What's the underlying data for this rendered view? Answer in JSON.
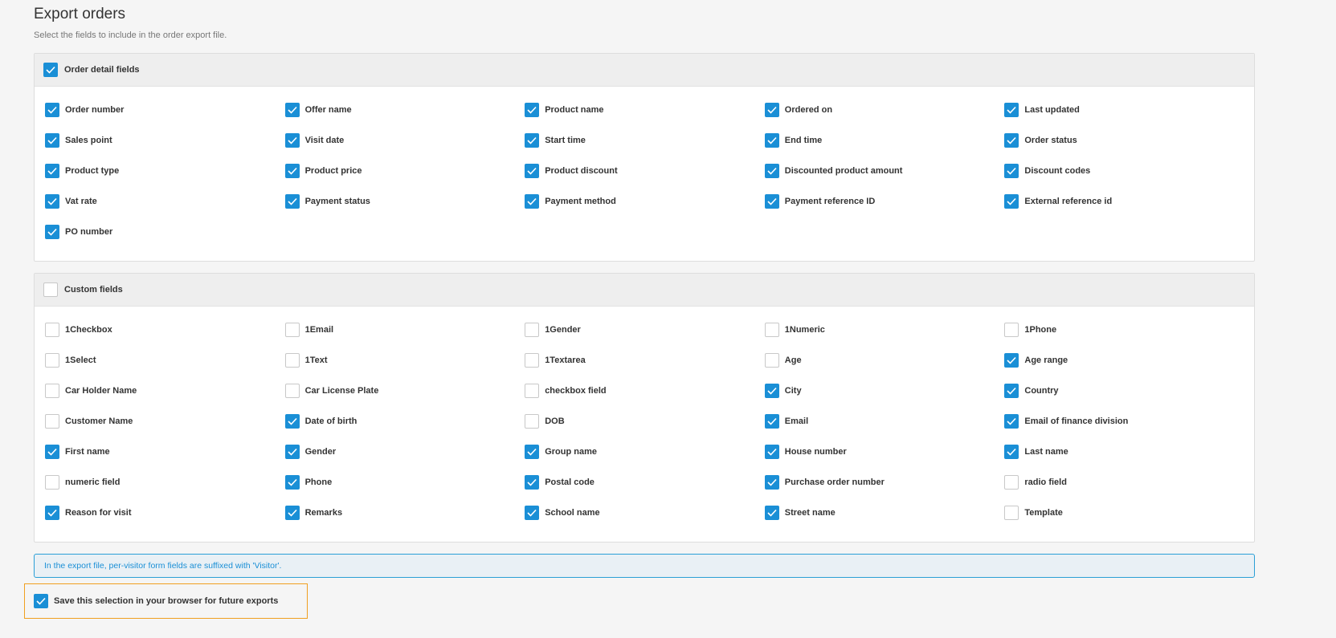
{
  "page": {
    "title": "Export orders",
    "subtitle": "Select the fields to include in the order export file."
  },
  "colors": {
    "accent": "#1a8fd6",
    "highlight_border": "#f0a020",
    "info_bg": "#e9f0f5"
  },
  "order_detail": {
    "title": "Order detail fields",
    "checked": true,
    "fields": [
      {
        "label": "Order number",
        "checked": true
      },
      {
        "label": "Offer name",
        "checked": true
      },
      {
        "label": "Product name",
        "checked": true
      },
      {
        "label": "Ordered on",
        "checked": true
      },
      {
        "label": "Last updated",
        "checked": true
      },
      {
        "label": "Sales point",
        "checked": true
      },
      {
        "label": "Visit date",
        "checked": true
      },
      {
        "label": "Start time",
        "checked": true
      },
      {
        "label": "End time",
        "checked": true
      },
      {
        "label": "Order status",
        "checked": true
      },
      {
        "label": "Product type",
        "checked": true
      },
      {
        "label": "Product price",
        "checked": true
      },
      {
        "label": "Product discount",
        "checked": true
      },
      {
        "label": "Discounted product amount",
        "checked": true
      },
      {
        "label": "Discount codes",
        "checked": true
      },
      {
        "label": "Vat rate",
        "checked": true
      },
      {
        "label": "Payment status",
        "checked": true
      },
      {
        "label": "Payment method",
        "checked": true
      },
      {
        "label": "Payment reference ID",
        "checked": true
      },
      {
        "label": "External reference id",
        "checked": true
      },
      {
        "label": "PO number",
        "checked": true
      }
    ]
  },
  "custom_fields": {
    "title": "Custom fields",
    "checked": false,
    "fields": [
      {
        "label": "1Checkbox",
        "checked": false
      },
      {
        "label": "1Email",
        "checked": false
      },
      {
        "label": "1Gender",
        "checked": false
      },
      {
        "label": "1Numeric",
        "checked": false
      },
      {
        "label": "1Phone",
        "checked": false
      },
      {
        "label": "1Select",
        "checked": false
      },
      {
        "label": "1Text",
        "checked": false
      },
      {
        "label": "1Textarea",
        "checked": false
      },
      {
        "label": "Age",
        "checked": false
      },
      {
        "label": "Age range",
        "checked": true
      },
      {
        "label": "Car Holder Name",
        "checked": false
      },
      {
        "label": "Car License Plate",
        "checked": false
      },
      {
        "label": "checkbox field",
        "checked": false
      },
      {
        "label": "City",
        "checked": true
      },
      {
        "label": "Country",
        "checked": true
      },
      {
        "label": "Customer Name",
        "checked": false
      },
      {
        "label": "Date of birth",
        "checked": true
      },
      {
        "label": "DOB",
        "checked": false
      },
      {
        "label": "Email",
        "checked": true
      },
      {
        "label": "Email of finance division",
        "checked": true
      },
      {
        "label": "First name",
        "checked": true
      },
      {
        "label": "Gender",
        "checked": true
      },
      {
        "label": "Group name",
        "checked": true
      },
      {
        "label": "House number",
        "checked": true
      },
      {
        "label": "Last name",
        "checked": true
      },
      {
        "label": "numeric field",
        "checked": false
      },
      {
        "label": "Phone",
        "checked": true
      },
      {
        "label": "Postal code",
        "checked": true
      },
      {
        "label": "Purchase order number",
        "checked": true
      },
      {
        "label": "radio field",
        "checked": false
      },
      {
        "label": "Reason for visit",
        "checked": true
      },
      {
        "label": "Remarks",
        "checked": true
      },
      {
        "label": "School name",
        "checked": true
      },
      {
        "label": "Street name",
        "checked": true
      },
      {
        "label": "Template",
        "checked": false
      }
    ]
  },
  "info": {
    "text": "In the export file, per-visitor form fields are suffixed with 'Visitor'."
  },
  "save_selection": {
    "label": "Save this selection in your browser for future exports",
    "checked": true
  }
}
